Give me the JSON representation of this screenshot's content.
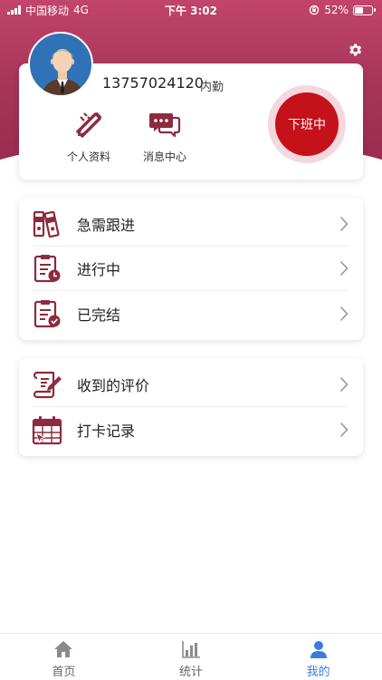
{
  "status_bar": {
    "carrier": "中国移动",
    "network": "4G",
    "time": "下午 3:02",
    "battery_percent": "52%",
    "battery_level": 0.52
  },
  "profile": {
    "phone": "13757024120",
    "role": "内勤",
    "avatar_icon": "avatar-person-icon"
  },
  "quick_actions": [
    {
      "label": "个人资料",
      "icon": "pencil-ruler-icon"
    },
    {
      "label": "消息中心",
      "icon": "chat-bubbles-icon"
    }
  ],
  "duty_button": {
    "label": "下班中"
  },
  "menu_group_1": [
    {
      "label": "急需跟进",
      "icon": "binders-icon"
    },
    {
      "label": "进行中",
      "icon": "clipboard-clock-icon"
    },
    {
      "label": "已完结",
      "icon": "clipboard-check-icon"
    }
  ],
  "menu_group_2": [
    {
      "label": "收到的评价",
      "icon": "scroll-pen-icon"
    },
    {
      "label": "打卡记录",
      "icon": "calendar-icon"
    }
  ],
  "tabs": [
    {
      "label": "首页",
      "icon": "home-icon",
      "active": false
    },
    {
      "label": "统计",
      "icon": "bar-chart-icon",
      "active": false
    },
    {
      "label": "我的",
      "icon": "user-icon",
      "active": true
    }
  ],
  "colors": {
    "brand": "#a63559",
    "icon": "#8e2a3f",
    "duty_button": "#c4111a",
    "active_tab": "#3a7de0"
  }
}
